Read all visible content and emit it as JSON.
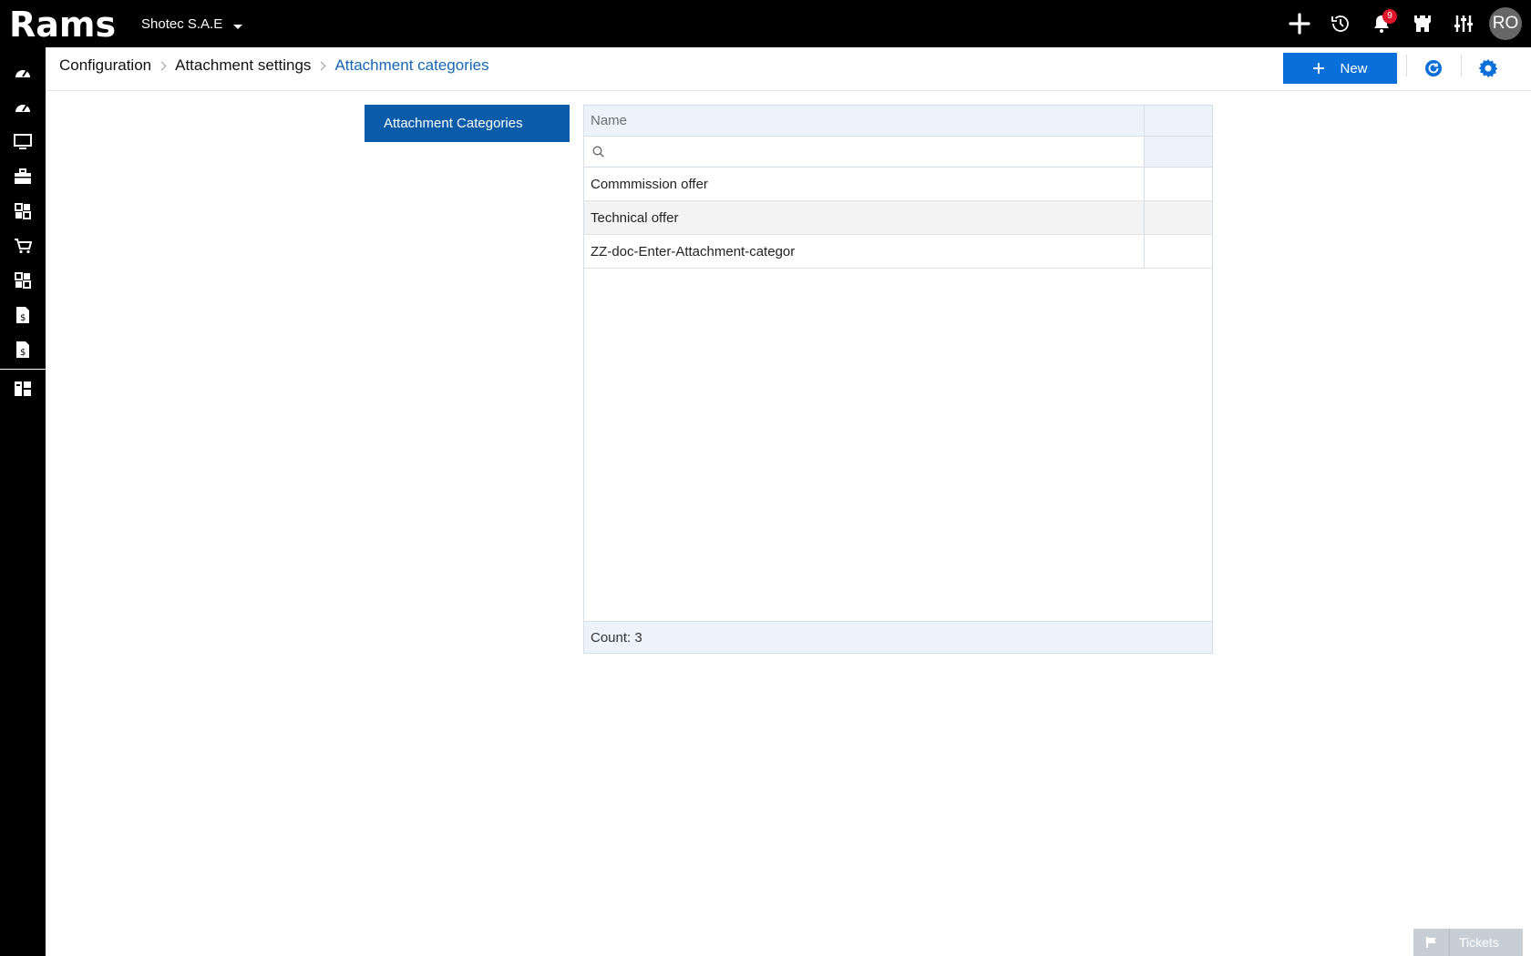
{
  "app": {
    "logo_text": "Rams",
    "company": "Shotec S.A.E",
    "notifications_count": "9",
    "user_initials": "RO"
  },
  "colors": {
    "accent": "#0a6fd8",
    "tab_active": "#0b5ca8",
    "header_bg": "#edf3fb",
    "badge": "#e0142b"
  },
  "breadcrumb": [
    "Configuration",
    "Attachment settings",
    "Attachment categories"
  ],
  "header": {
    "new_label": "New"
  },
  "left_tabs": [
    {
      "label": "Attachment Categories",
      "active": true
    }
  ],
  "grid": {
    "columns": [
      "Name",
      ""
    ],
    "filter_placeholder": "",
    "rows": [
      {
        "name": "Commmission offer"
      },
      {
        "name": "Technical offer"
      },
      {
        "name": "ZZ-doc-Enter-Attachment-categor"
      }
    ],
    "footer": "Count: 3"
  },
  "tickets": {
    "label": "Tickets"
  },
  "sidebar_icons": [
    "dashboard-icon",
    "dashboard-icon",
    "monitor-icon",
    "briefcase-icon",
    "grid-icon",
    "cart-icon",
    "grid-icon",
    "invoice-icon",
    "invoice-icon",
    "modules-icon"
  ]
}
